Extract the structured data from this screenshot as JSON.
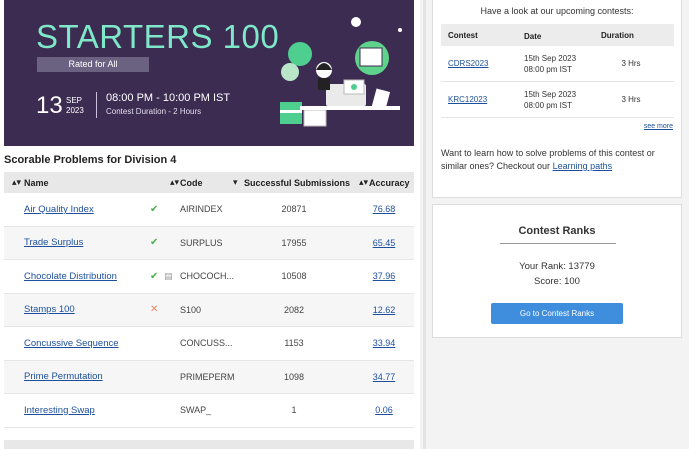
{
  "banner": {
    "title": "STARTERS 100",
    "rated": "Rated for All",
    "day": "13",
    "month": "SEP",
    "year": "2023",
    "time": "08:00 PM - 10:00 PM IST",
    "duration": "Contest Duration - 2 Hours",
    "accent_color": "#7ee8c9",
    "bg_color": "#3d2c52"
  },
  "problems": {
    "section_title": "Scorable Problems for Division 4",
    "headers": {
      "name": "Name",
      "code": "Code",
      "subs": "Successful Submissions",
      "acc": "Accuracy"
    },
    "rows": [
      {
        "name": "Air Quality Index",
        "status": "✔",
        "status_type": "ok",
        "doc": "",
        "code": "AIRINDEX",
        "subs": "20871",
        "acc": "76.68"
      },
      {
        "name": "Trade Surplus",
        "status": "✔",
        "status_type": "ok",
        "doc": "",
        "code": "SURPLUS",
        "subs": "17955",
        "acc": "65.45"
      },
      {
        "name": "Chocolate Distribution",
        "status": "✔",
        "status_type": "ok",
        "doc": "▤",
        "code": "CHOCOCH...",
        "subs": "10508",
        "acc": "37.96"
      },
      {
        "name": "Stamps 100",
        "status": "✕",
        "status_type": "bad",
        "doc": "",
        "code": "S100",
        "subs": "2082",
        "acc": "12.62"
      },
      {
        "name": "Concussive Sequence",
        "status": "",
        "status_type": "",
        "doc": "",
        "code": "CONCUSS...",
        "subs": "1153",
        "acc": "33.94"
      },
      {
        "name": "Prime Permutation",
        "status": "",
        "status_type": "",
        "doc": "",
        "code": "PRIMEPERM",
        "subs": "1098",
        "acc": "34.77"
      },
      {
        "name": "Interesting Swap",
        "status": "",
        "status_type": "",
        "doc": "",
        "code": "SWAP_",
        "subs": "1",
        "acc": "0.06"
      }
    ]
  },
  "upcoming": {
    "heading": "Have a look at our upcoming contests:",
    "headers": {
      "contest": "Contest",
      "date": "Date",
      "duration": "Duration"
    },
    "rows": [
      {
        "contest": "CDRS2023",
        "date1": "15th Sep 2023",
        "date2": "08:00 pm IST",
        "duration": "3 Hrs"
      },
      {
        "contest": "KRC12023",
        "date1": "15th Sep 2023",
        "date2": "08:00 pm IST",
        "duration": "3 Hrs"
      }
    ],
    "see_more": "see more",
    "learn_text": "Want to learn how to solve problems of this contest or similar ones? Checkout our ",
    "learn_link": "Learning paths"
  },
  "ranks": {
    "title": "Contest Ranks",
    "your_rank": "Your Rank: 13779",
    "score": "Score: 100",
    "button": "Go to Contest Ranks",
    "button_color": "#3f8ede"
  }
}
